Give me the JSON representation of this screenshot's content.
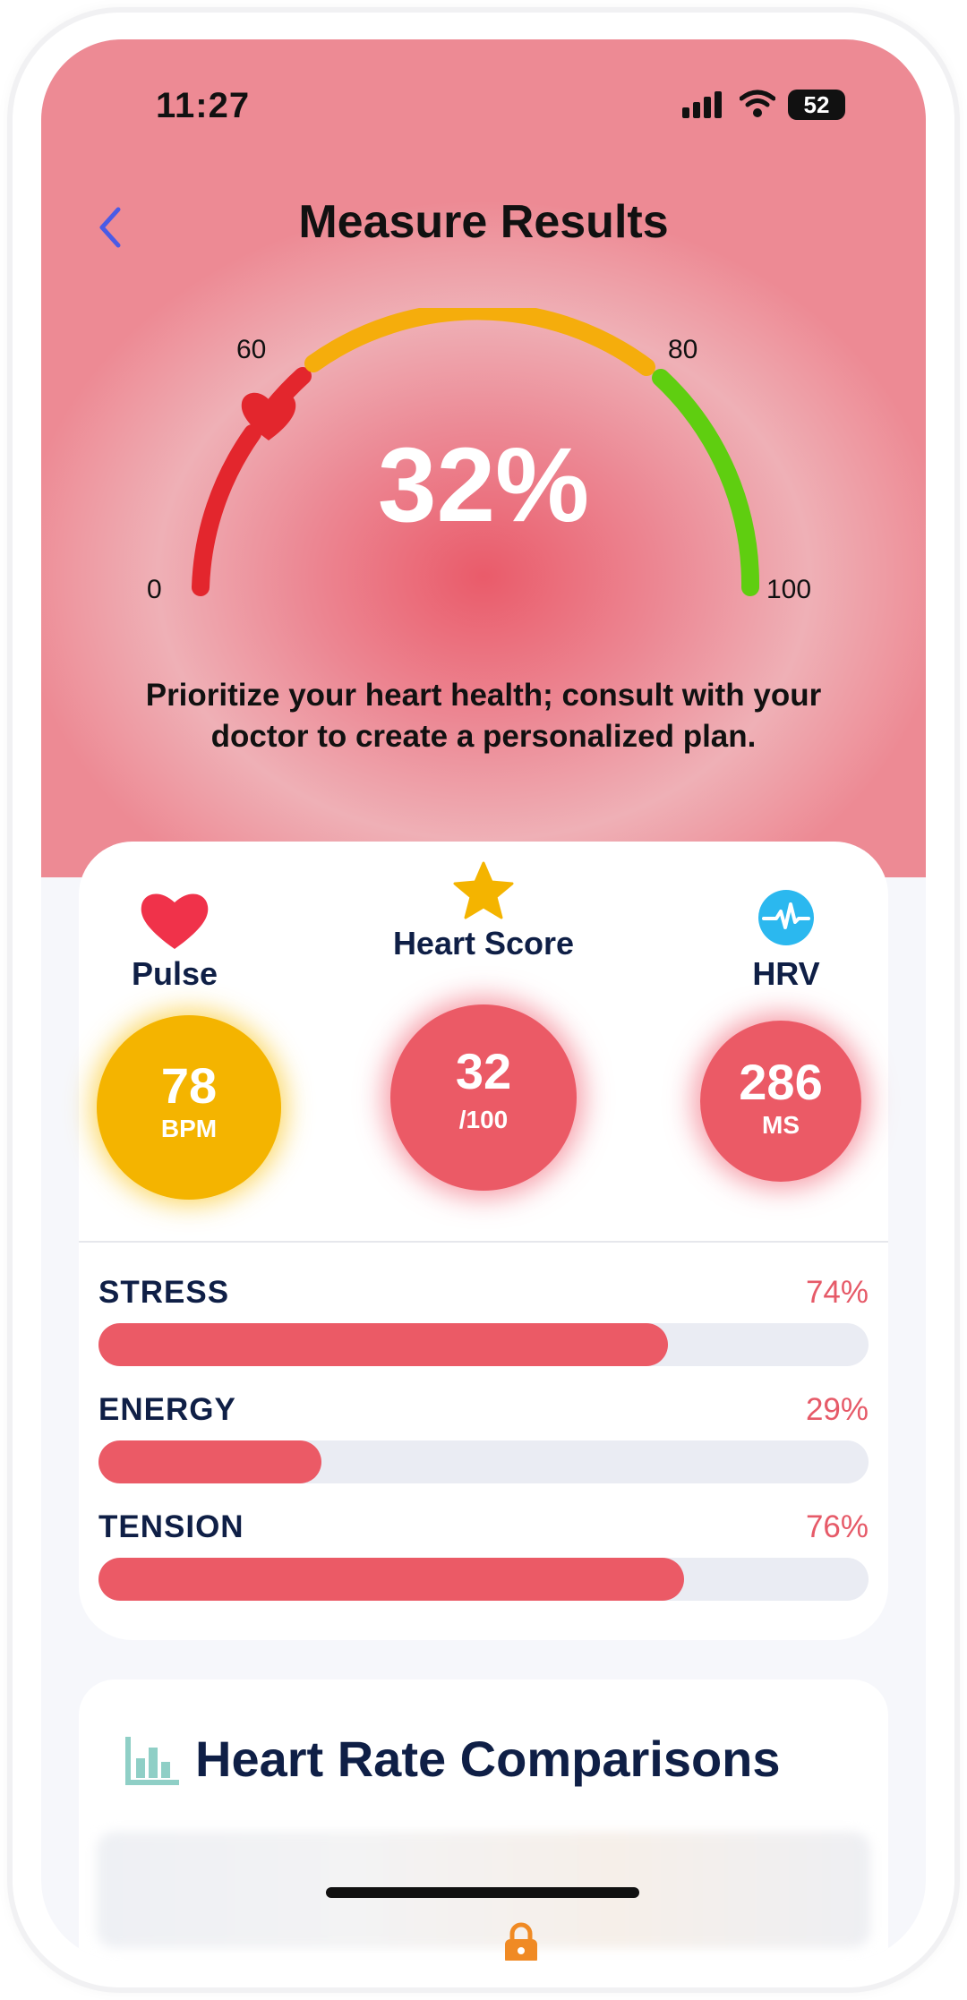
{
  "status_bar": {
    "time": "11:27",
    "battery": "52"
  },
  "header": {
    "title": "Measure Results"
  },
  "gauge": {
    "min_label": "0",
    "label_60": "60",
    "label_80": "80",
    "max_label": "100",
    "value_text": "32%",
    "value": 32
  },
  "advice": "Prioritize your heart health; consult with your doctor to create a personalized plan.",
  "metrics": {
    "pulse": {
      "label": "Pulse",
      "value": "78",
      "unit": "BPM"
    },
    "heart_score": {
      "label": "Heart Score",
      "value": "32",
      "unit": "/100"
    },
    "hrv": {
      "label": "HRV",
      "value": "286",
      "unit": "MS"
    }
  },
  "bars": [
    {
      "name": "STRESS",
      "pct_text": "74%",
      "value": 74
    },
    {
      "name": "ENERGY",
      "pct_text": "29%",
      "value": 29
    },
    {
      "name": "TENSION",
      "pct_text": "76%",
      "value": 76
    }
  ],
  "comparisons": {
    "title": "Heart Rate Comparisons"
  },
  "colors": {
    "accent_red": "#eb5a66",
    "pulse_yellow": "#f4b400",
    "navy": "#0f1f46"
  }
}
